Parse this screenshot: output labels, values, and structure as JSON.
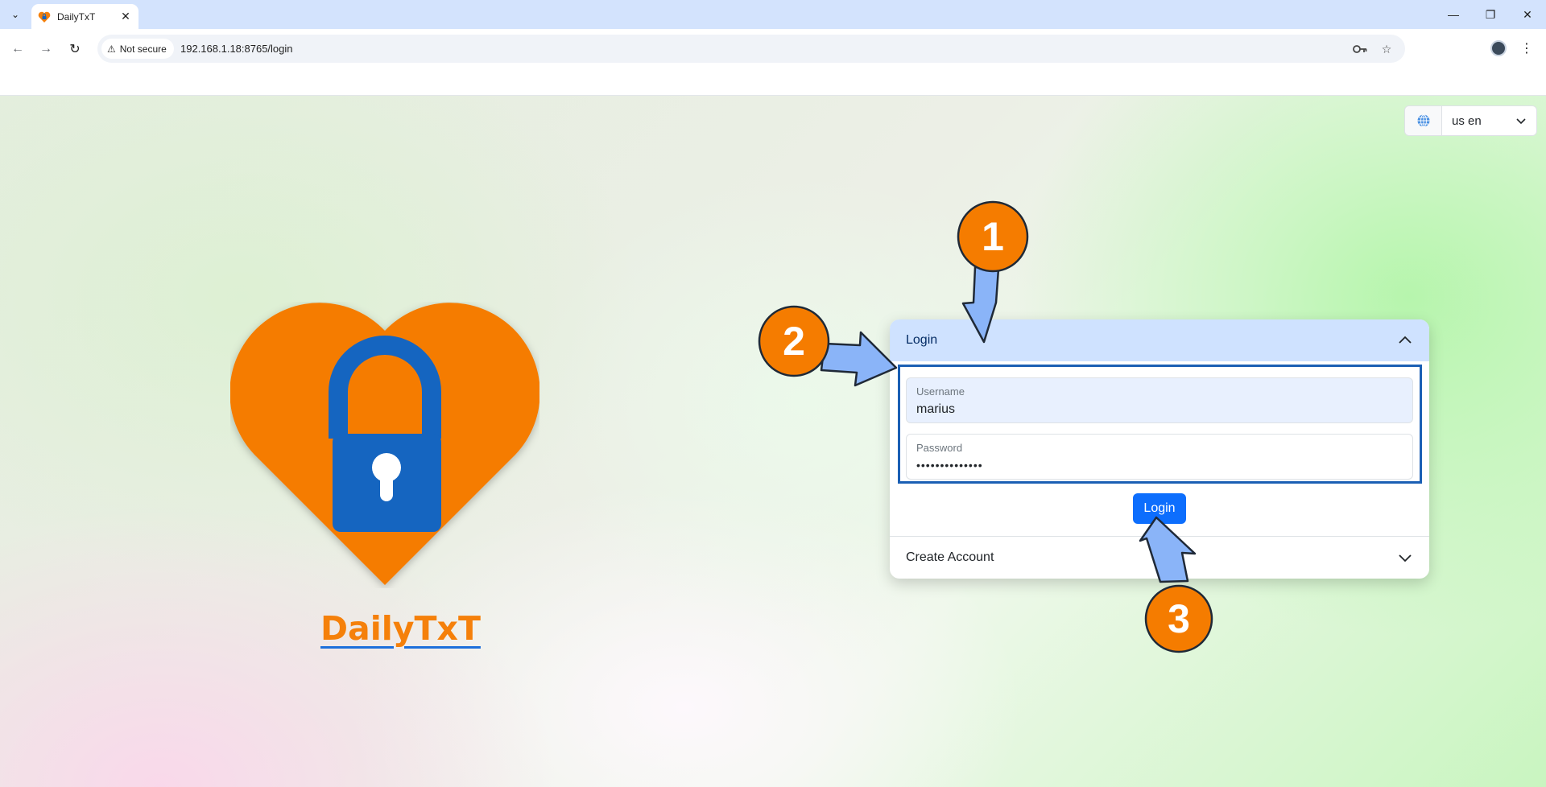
{
  "browser": {
    "tab_title": "DailyTxT",
    "security_label": "Not secure",
    "url": "192.168.1.18:8765/login"
  },
  "icons": {
    "tab_list": "chevron-down-icon",
    "close_tab": "close-icon",
    "back": "back-arrow-icon",
    "forward": "forward-arrow-icon",
    "reload": "reload-icon",
    "warning": "warning-icon",
    "password_manager": "key-icon",
    "bookmark": "star-icon",
    "menu": "kebab-menu-icon",
    "language": "globe-icon"
  },
  "language_selector": {
    "value": "us en"
  },
  "brand": {
    "name": "DailyTxT"
  },
  "login_form": {
    "header": "Login",
    "username_label": "Username",
    "username_value": "marius",
    "password_label": "Password",
    "password_value": "••••••••••••••",
    "submit_label": "Login",
    "create_account_header": "Create Account"
  },
  "annotations": {
    "step_1": "1",
    "step_2": "2",
    "step_3": "3"
  },
  "colors": {
    "brand_orange": "#f5800a",
    "brand_blue": "#1565c0",
    "primary_button": "#0d6efd",
    "accordion_active": "#cfe2ff",
    "annotation_arrow": "#8ab4f8"
  }
}
